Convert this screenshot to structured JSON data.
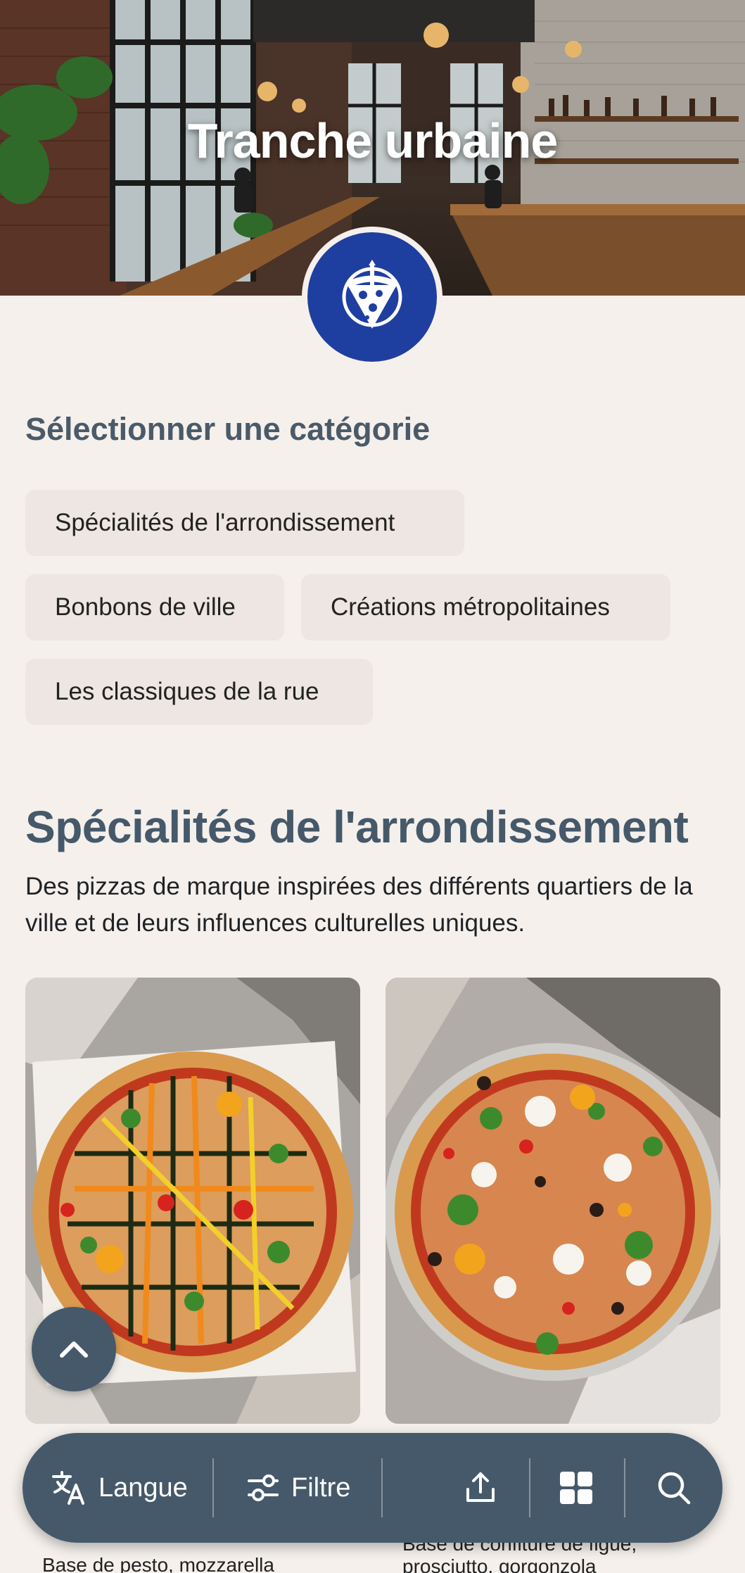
{
  "hero": {
    "title": "Tranche urbaine"
  },
  "category": {
    "heading": "Sélectionner une catégorie",
    "chips": [
      "Spécialités de l'arrondissement",
      "Bonbons de ville",
      "Créations métropolitaines",
      "Les classiques de la rue"
    ]
  },
  "section": {
    "title": "Spécialités de l'arrondissement",
    "description": "Des pizzas de marque inspirées des différents quartiers de la ville et de leurs influences culturelles uniques."
  },
  "cards": [
    {
      "text_line1": "Base de pesto, mozzarella"
    },
    {
      "text_line1": "Base de confiture de figue,",
      "text_line2": "prosciutto, gorgonzola"
    }
  ],
  "bottom_bar": {
    "language_label": "Langue",
    "filter_label": "Filtre"
  },
  "colors": {
    "accent": "#46596a",
    "logo_blue": "#1e3fa0",
    "background": "#f5f0ec",
    "chip": "#ede6e2"
  }
}
